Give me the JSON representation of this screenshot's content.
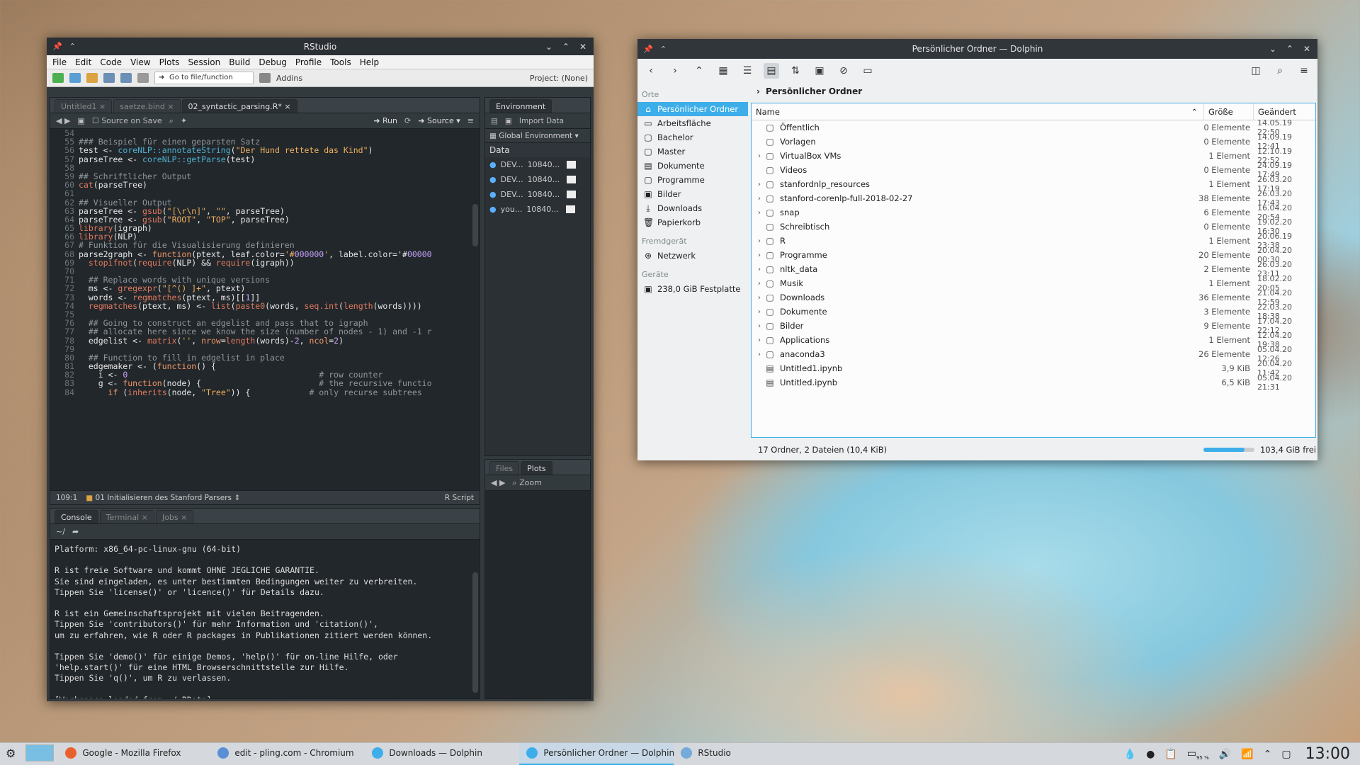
{
  "rstudio": {
    "title": "RStudio",
    "menu": [
      "File",
      "Edit",
      "Code",
      "View",
      "Plots",
      "Session",
      "Build",
      "Debug",
      "Profile",
      "Tools",
      "Help"
    ],
    "toolbar": {
      "goto": "Go to file/function",
      "addins": "Addins",
      "project": "Project: (None)"
    },
    "source_tabs": [
      "Untitled1",
      "saetze.bind",
      "02_syntactic_parsing.R*"
    ],
    "source_tools": {
      "source_on_save": "Source on Save",
      "run": "Run",
      "source": "Source"
    },
    "code": [
      {
        "n": "54",
        "t": ""
      },
      {
        "n": "55",
        "t": "### Beispiel für einen geparsten Satz",
        "k": "cm"
      },
      {
        "n": "56",
        "t": "test <- coreNLP::annotateString(\"Der Hund rettete das Kind\")"
      },
      {
        "n": "57",
        "t": "parseTree <- coreNLP::getParse(test)"
      },
      {
        "n": "58",
        "t": ""
      },
      {
        "n": "59",
        "t": "## Schriftlicher Output",
        "k": "cm"
      },
      {
        "n": "60",
        "t": "cat(parseTree)"
      },
      {
        "n": "61",
        "t": ""
      },
      {
        "n": "62",
        "t": "## Visueller Output",
        "k": "cm"
      },
      {
        "n": "63",
        "t": "parseTree <- gsub(\"[\\r\\n]\", \"\", parseTree)"
      },
      {
        "n": "64",
        "t": "parseTree <- gsub(\"ROOT\", \"TOP\", parseTree)"
      },
      {
        "n": "65",
        "t": "library(igraph)"
      },
      {
        "n": "66",
        "t": "library(NLP)"
      },
      {
        "n": "67",
        "t": "# Funktion für die Visualisierung definieren",
        "k": "cm"
      },
      {
        "n": "68",
        "t": "parse2graph <- function(ptext, leaf.color='#000000', label.color='#00000"
      },
      {
        "n": "69",
        "t": "  stopifnot(require(NLP) && require(igraph))"
      },
      {
        "n": "70",
        "t": ""
      },
      {
        "n": "71",
        "t": "  ## Replace words with unique versions",
        "k": "cm"
      },
      {
        "n": "72",
        "t": "  ms <- gregexpr(\"[^() ]+\", ptext)"
      },
      {
        "n": "73",
        "t": "  words <- regmatches(ptext, ms)[[1]]"
      },
      {
        "n": "74",
        "t": "  regmatches(ptext, ms) <- list(paste0(words, seq.int(length(words))))"
      },
      {
        "n": "75",
        "t": ""
      },
      {
        "n": "76",
        "t": "  ## Going to construct an edgelist and pass that to igraph",
        "k": "cm"
      },
      {
        "n": "77",
        "t": "  ## allocate here since we know the size (number of nodes - 1) and -1 r",
        "k": "cm"
      },
      {
        "n": "78",
        "t": "  edgelist <- matrix('', nrow=length(words)-2, ncol=2)"
      },
      {
        "n": "79",
        "t": ""
      },
      {
        "n": "80",
        "t": "  ## Function to fill in edgelist in place",
        "k": "cm"
      },
      {
        "n": "81",
        "t": "  edgemaker <- (function() {"
      },
      {
        "n": "82",
        "t": "    i <- 0                                       # row counter"
      },
      {
        "n": "83",
        "t": "    g <- function(node) {                        # the recursive functio"
      },
      {
        "n": "84",
        "t": "      if (inherits(node, \"Tree\")) {            # only recurse subtrees"
      }
    ],
    "editor_status": {
      "pos": "109:1",
      "section": "01 Initialisieren des Stanford Parsers",
      "type": "R Script"
    },
    "env_tabs": [
      "Environment"
    ],
    "env_tools": {
      "import": "Import Data",
      "scope": "Global Environment"
    },
    "env_header": "Data",
    "env_rows": [
      {
        "name": "DEV...",
        "val": "10840..."
      },
      {
        "name": "DEV...",
        "val": "10840..."
      },
      {
        "name": "DEV...",
        "val": "10840..."
      },
      {
        "name": "you...",
        "val": "10840..."
      }
    ],
    "console_tabs": [
      "Console",
      "Terminal",
      "Jobs"
    ],
    "console_path": "~/",
    "console_text": "Platform: x86_64-pc-linux-gnu (64-bit)\n\nR ist freie Software und kommt OHNE JEGLICHE GARANTIE.\nSie sind eingeladen, es unter bestimmten Bedingungen weiter zu verbreiten.\nTippen Sie 'license()' or 'licence()' für Details dazu.\n\nR ist ein Gemeinschaftsprojekt mit vielen Beitragenden.\nTippen Sie 'contributors()' für mehr Information und 'citation()',\num zu erfahren, wie R oder R packages in Publikationen zitiert werden können.\n\nTippen Sie 'demo()' für einige Demos, 'help()' für on-line Hilfe, oder\n'help.start()' für eine HTML Browserschnittstelle zur Hilfe.\nTippen Sie 'q()', um R zu verlassen.\n\n[Workspace loaded from ~/.RData]",
    "console_prompt": ">",
    "files_tabs": [
      "Files",
      "Plots"
    ],
    "plots_zoom": "Zoom"
  },
  "dolphin": {
    "title": "Persönlicher Ordner — Dolphin",
    "places_headers": {
      "orte": "Orte",
      "fremd": "Fremdgerät",
      "geraete": "Geräte"
    },
    "places": [
      {
        "label": "Persönlicher Ordner",
        "icon": "home-icon",
        "sel": true
      },
      {
        "label": "Arbeitsfläche",
        "icon": "desktop-icon"
      },
      {
        "label": "Bachelor",
        "icon": "folder-icon"
      },
      {
        "label": "Master",
        "icon": "folder-icon"
      },
      {
        "label": "Dokumente",
        "icon": "document-icon"
      },
      {
        "label": "Programme",
        "icon": "folder-icon"
      },
      {
        "label": "Bilder",
        "icon": "image-icon"
      },
      {
        "label": "Downloads",
        "icon": "download-icon"
      },
      {
        "label": "Papierkorb",
        "icon": "trash-icon"
      }
    ],
    "network": "Netzwerk",
    "device": "238,0 GiB Festplatte",
    "breadcrumb": "Persönlicher Ordner",
    "columns": {
      "name": "Name",
      "size": "Größe",
      "date": "Geändert"
    },
    "files": [
      {
        "name": "Öffentlich",
        "size": "0 Elemente",
        "date": "14.05.19 22:50",
        "exp": false
      },
      {
        "name": "Vorlagen",
        "size": "0 Elemente",
        "date": "14.09.19 12:41",
        "exp": false
      },
      {
        "name": "VirtualBox VMs",
        "size": "1 Element",
        "date": "12.10.19 22:52",
        "exp": true
      },
      {
        "name": "Videos",
        "size": "0 Elemente",
        "date": "24.09.19 17:49",
        "exp": false
      },
      {
        "name": "stanfordnlp_resources",
        "size": "1 Element",
        "date": "26.03.20 17:19",
        "exp": true
      },
      {
        "name": "stanford-corenlp-full-2018-02-27",
        "size": "38 Elemente",
        "date": "26.03.20 17:43",
        "exp": true
      },
      {
        "name": "snap",
        "size": "6 Elemente",
        "date": "16.04.20 20:54",
        "exp": true
      },
      {
        "name": "Schreibtisch",
        "size": "0 Elemente",
        "date": "19.02.20 16:30",
        "exp": false
      },
      {
        "name": "R",
        "size": "1 Element",
        "date": "20.06.19 23:38",
        "exp": true
      },
      {
        "name": "Programme",
        "size": "20 Elemente",
        "date": "20.04.20 00:30",
        "exp": true
      },
      {
        "name": "nltk_data",
        "size": "2 Elemente",
        "date": "26.03.20 23:11",
        "exp": true
      },
      {
        "name": "Musik",
        "size": "1 Element",
        "date": "18.02.20 20:05",
        "exp": true
      },
      {
        "name": "Downloads",
        "size": "36 Elemente",
        "date": "21.04.20 12:59",
        "exp": true
      },
      {
        "name": "Dokumente",
        "size": "3 Elemente",
        "date": "22.03.20 18:38",
        "exp": true
      },
      {
        "name": "Bilder",
        "size": "9 Elemente",
        "date": "17.04.20 22:12",
        "exp": true
      },
      {
        "name": "Applications",
        "size": "1 Element",
        "date": "12.04.20 19:38",
        "exp": true
      },
      {
        "name": "anaconda3",
        "size": "26 Elemente",
        "date": "05.04.20 12:26",
        "exp": true
      },
      {
        "name": "Untitled1.ipynb",
        "size": "3,9 KiB",
        "date": "20.04.20 11:42",
        "exp": false,
        "file": true
      },
      {
        "name": "Untitled.ipynb",
        "size": "6,5 KiB",
        "date": "05.04.20 21:31",
        "exp": false,
        "file": true
      }
    ],
    "status": "17 Ordner, 2 Dateien (10,4 KiB)",
    "free": "103,4 GiB frei",
    "used_fraction": 0.8
  },
  "taskbar": {
    "tasks": [
      {
        "label": "Google - Mozilla Firefox",
        "color": "#e8602c"
      },
      {
        "label": "edit - pling.com - Chromium",
        "color": "#5a8fd6"
      },
      {
        "label": "Downloads — Dolphin",
        "color": "#3daee9"
      },
      {
        "label": "Persönlicher Ordner — Dolphin",
        "color": "#3daee9",
        "active": true
      },
      {
        "label": "RStudio",
        "color": "#75aadb"
      }
    ],
    "battery": "95 %",
    "clock": "13:00"
  }
}
